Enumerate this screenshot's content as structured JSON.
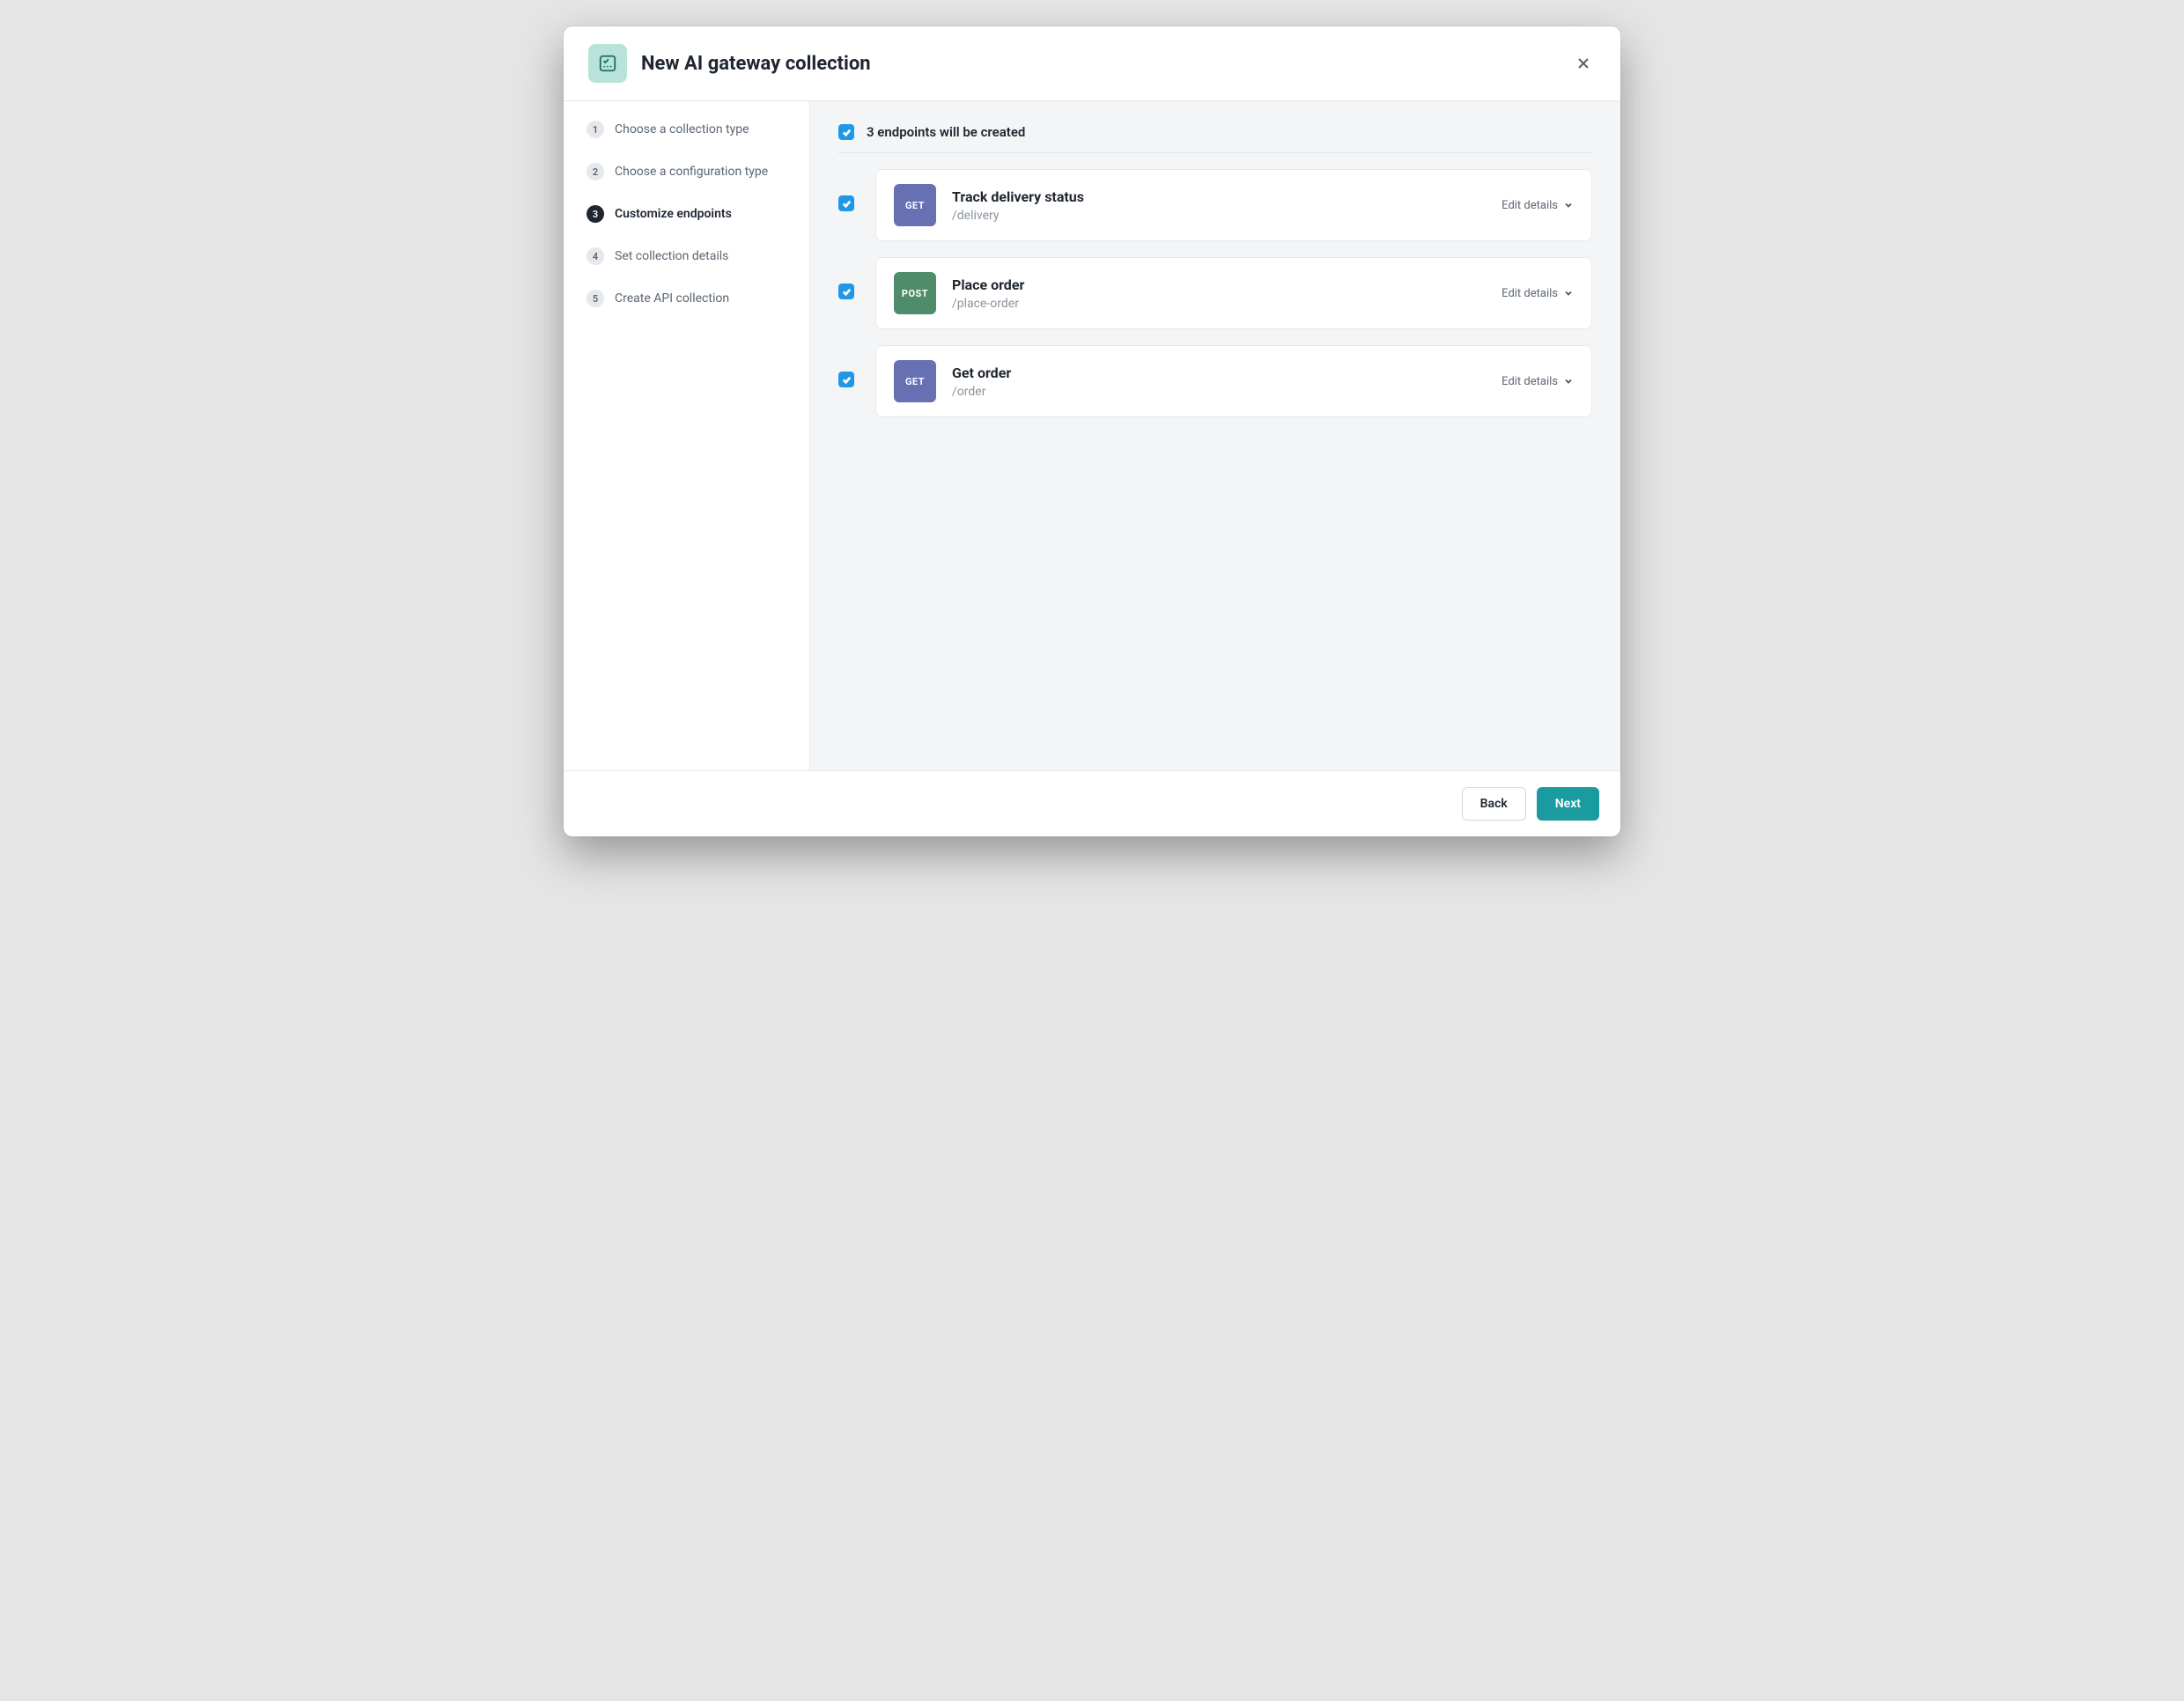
{
  "modal": {
    "title": "New AI gateway collection"
  },
  "steps": [
    {
      "num": "1",
      "label": "Choose a collection type"
    },
    {
      "num": "2",
      "label": "Choose a configuration type"
    },
    {
      "num": "3",
      "label": "Customize endpoints"
    },
    {
      "num": "4",
      "label": "Set collection details"
    },
    {
      "num": "5",
      "label": "Create API collection"
    }
  ],
  "active_step_index": 2,
  "content": {
    "select_all_label": "3 endpoints will be created",
    "edit_label": "Edit details",
    "endpoints": [
      {
        "method": "GET",
        "method_class": "get",
        "title": "Track delivery status",
        "path": "/delivery"
      },
      {
        "method": "POST",
        "method_class": "post",
        "title": "Place order",
        "path": "/place-order"
      },
      {
        "method": "GET",
        "method_class": "get",
        "title": "Get order",
        "path": "/order"
      }
    ]
  },
  "footer": {
    "back": "Back",
    "next": "Next"
  }
}
